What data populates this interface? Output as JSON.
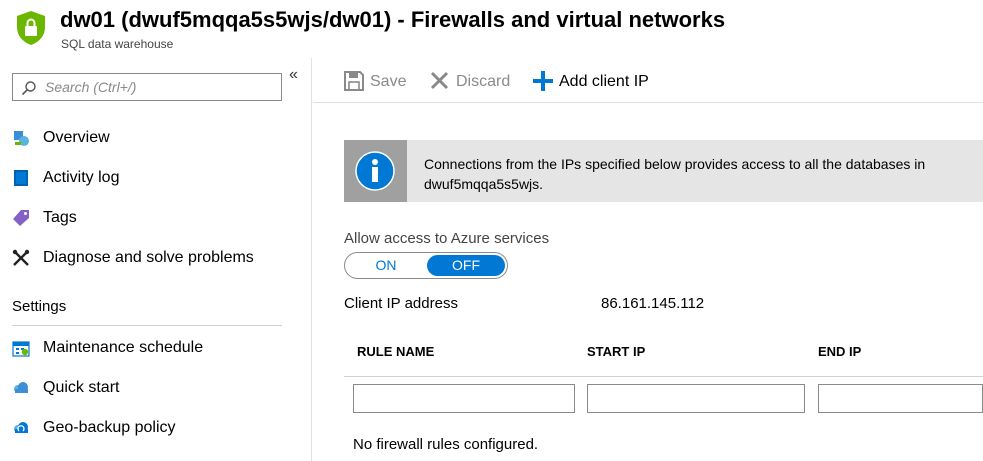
{
  "header": {
    "title": "dw01 (dwuf5mqqa5s5wjs/dw01) - Firewalls and virtual networks",
    "subtitle": "SQL data warehouse",
    "logo_color": "#6bb700"
  },
  "sidebar": {
    "search_placeholder": "Search (Ctrl+/)",
    "collapse_glyph": "«",
    "items": [
      {
        "label": "Overview",
        "icon": "overview-icon"
      },
      {
        "label": "Activity log",
        "icon": "activity-log-icon"
      },
      {
        "label": "Tags",
        "icon": "tag-icon"
      },
      {
        "label": "Diagnose and solve problems",
        "icon": "wrench-icon"
      }
    ],
    "section_settings": "Settings",
    "settings_items": [
      {
        "label": "Maintenance schedule",
        "icon": "calendar-icon"
      },
      {
        "label": "Quick start",
        "icon": "cloud-icon"
      },
      {
        "label": "Geo-backup policy",
        "icon": "cloud-backup-icon"
      }
    ]
  },
  "toolbar": {
    "save_label": "Save",
    "discard_label": "Discard",
    "add_client_ip_label": "Add client IP"
  },
  "info": {
    "message": "Connections from the IPs specified below provides access to all the databases in dwuf5mqqa5s5wjs."
  },
  "azure_access": {
    "label": "Allow access to Azure services",
    "on_label": "ON",
    "off_label": "OFF",
    "selected": "OFF"
  },
  "client_ip": {
    "label": "Client IP address",
    "value": "86.161.145.112"
  },
  "rules_table": {
    "columns": [
      "RULE NAME",
      "START IP",
      "END IP"
    ],
    "new_row": {
      "rule_name": "",
      "start_ip": "",
      "end_ip": ""
    },
    "empty_message": "No firewall rules configured."
  },
  "colors": {
    "accent": "#0078d4",
    "disabled_text": "#8a8a8a",
    "info_background": "#e5e5e5"
  }
}
